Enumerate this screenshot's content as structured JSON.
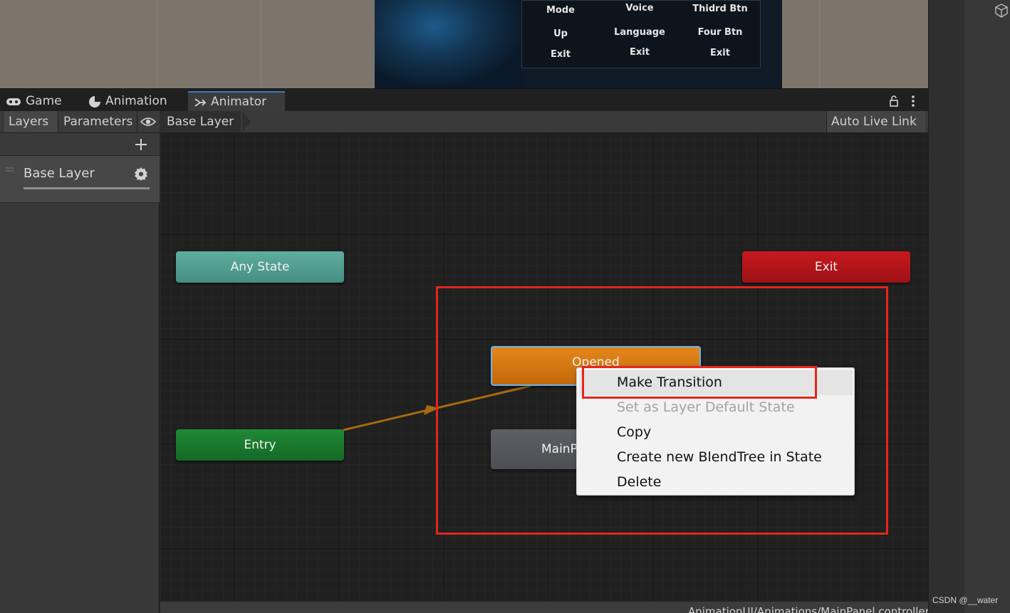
{
  "scene": {
    "game_menu_columns": [
      [
        "Mode",
        "Up",
        "Exit"
      ],
      [
        "Voice",
        "Language",
        "Exit"
      ],
      [
        "Thidrd Btn",
        "Four Btn",
        "Exit"
      ]
    ]
  },
  "tabs": [
    {
      "label": "Game",
      "icon": "gamepad-icon"
    },
    {
      "label": "Animation",
      "icon": "clock-icon"
    },
    {
      "label": "Animator",
      "icon": "animator-icon",
      "active": true
    }
  ],
  "toolbar": {
    "layers_label": "Layers",
    "parameters_label": "Parameters",
    "breadcrumb": "Base Layer",
    "auto_live_link": "Auto Live Link"
  },
  "layers_panel": {
    "add_icon": "plus-icon",
    "layer_name": "Base Layer",
    "settings_icon": "gear-icon"
  },
  "graph": {
    "nodes": {
      "any_state": "Any State",
      "exit": "Exit",
      "entry": "Entry",
      "opened": "Opened",
      "main_panel": "MainP"
    }
  },
  "context_menu": {
    "items": [
      {
        "label": "Make Transition",
        "enabled": true,
        "highlighted": true
      },
      {
        "label": "Set as Layer Default State",
        "enabled": false
      },
      {
        "label": "Copy",
        "enabled": true
      },
      {
        "label": "Create new BlendTree in State",
        "enabled": true
      },
      {
        "label": "Delete",
        "enabled": true
      }
    ]
  },
  "status_bar": {
    "path": "AnimationUI/Animations/MainPanel.controller"
  },
  "watermark": "CSDN @__water",
  "colors": {
    "any_state": "#4f9a8e",
    "exit": "#b0161a",
    "entry": "#18792d",
    "opened": "#d9770f",
    "default_state": "#55575b",
    "annotation_red": "#e5251d",
    "transition_arrow": "#a76a10"
  }
}
